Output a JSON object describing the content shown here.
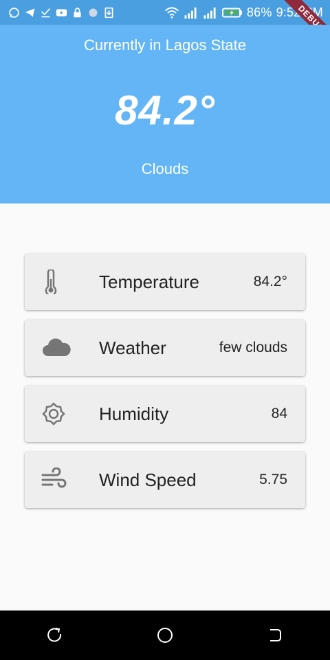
{
  "status_bar": {
    "battery": "86%",
    "time": "9:52 PM",
    "icons": [
      "whatsapp-icon",
      "telegram-icon",
      "check-download-icon",
      "youtube-icon",
      "lock-icon",
      "circle-icon",
      "download-icon",
      "wifi-icon",
      "signal-icon",
      "signal-icon",
      "battery-icon"
    ]
  },
  "debug_banner": "DEBUG",
  "header": {
    "location": "Currently in Lagos State",
    "temperature": "84.2°",
    "condition": "Clouds",
    "bg_color": "#64b5f6"
  },
  "cards": [
    {
      "label": "Temperature",
      "value": "84.2°",
      "icon": "thermometer-icon"
    },
    {
      "label": "Weather",
      "value": "few clouds",
      "icon": "cloud-icon"
    },
    {
      "label": "Humidity",
      "value": "84",
      "icon": "sun-icon"
    },
    {
      "label": "Wind Speed",
      "value": "5.75",
      "icon": "wind-icon"
    }
  ],
  "nav": {
    "buttons": [
      "recent-apps",
      "home",
      "back"
    ]
  }
}
